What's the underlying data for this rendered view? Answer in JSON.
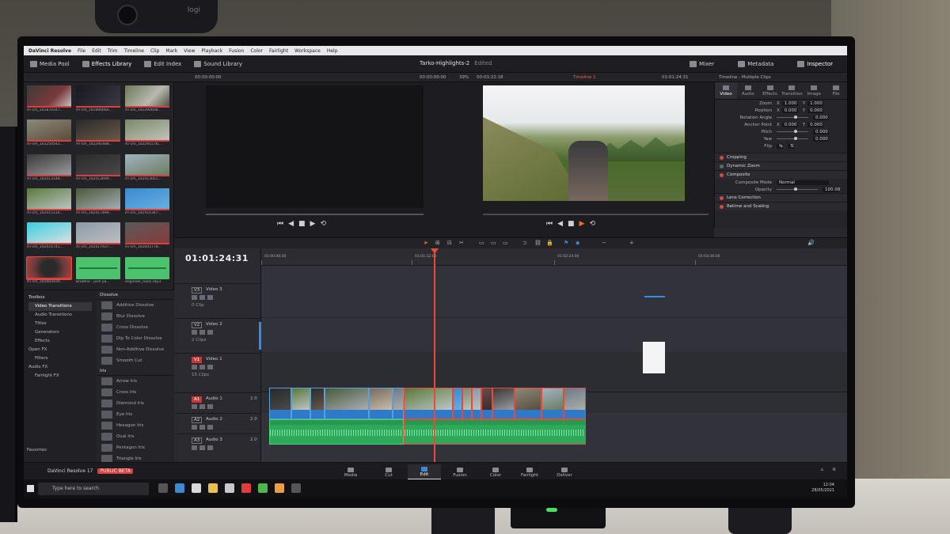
{
  "app": {
    "name": "DaVinci Resolve",
    "project_title": "Tarko-Highlights-2",
    "project_state": "Edited",
    "footer_name": "DaVinci Resolve 17",
    "footer_badge": "PUBLIC BETA"
  },
  "menu": [
    "File",
    "Edit",
    "Trim",
    "Timeline",
    "Clip",
    "Mark",
    "View",
    "Playback",
    "Fusion",
    "Color",
    "Fairlight",
    "Workspace",
    "Help"
  ],
  "toolbar": {
    "media_pool": "Media Pool",
    "effects_library": "Effects Library",
    "edit_index": "Edit Index",
    "sound_library": "Sound Library",
    "mixer": "Mixer",
    "metadata": "Metadata",
    "inspector": "Inspector"
  },
  "subbar": {
    "source_tc": "00:00:00:00",
    "src_duration": "00:00:00:00",
    "zoom": "39%",
    "prog_tc_left": "00:03:22:18",
    "timeline_name": "Timeline 1",
    "prog_tc": "01:01:24:31",
    "inspector_title": "Timeline - Multiple Clips"
  },
  "media_clips": [
    {
      "label": "AT-cm_101870547..."
    },
    {
      "label": "AT-cm_101990666..."
    },
    {
      "label": "AT-cm_102290606..."
    },
    {
      "label": "AT-cm_102250542..."
    },
    {
      "label": "AT-cm_102291488..."
    },
    {
      "label": "AT-cm_102291578..."
    },
    {
      "label": "AT-cm_102413148..."
    },
    {
      "label": "AT-cm_102413699..."
    },
    {
      "label": "AT-cm_102413051..."
    },
    {
      "label": "AT-cm_102415116..."
    },
    {
      "label": "AT-cm_102417499..."
    },
    {
      "label": "AT-cm_102416347..."
    },
    {
      "label": "AT-cm_102416741..."
    },
    {
      "label": "AT-cm_102417937..."
    },
    {
      "label": "AT-cm_102605778..."
    },
    {
      "label": "AT-cm_102605939..."
    },
    {
      "label": "Breathe - josh pa..."
    },
    {
      "label": "engineer_no01.mp3"
    }
  ],
  "effects": {
    "tree": [
      "Toolbox",
      "Video Transitions",
      "Audio Transitions",
      "Titles",
      "Generators",
      "Effects",
      "Open FX",
      "Filters",
      "Audio FX",
      "Fairlight FX"
    ],
    "favorites": "Favorites",
    "dissolve_header": "Dissolve",
    "dissolve": [
      "Additive Dissolve",
      "Blur Dissolve",
      "Cross Dissolve",
      "Dip To Color Dissolve",
      "Non-Additive Dissolve",
      "Smooth Cut"
    ],
    "iris_header": "Iris",
    "iris": [
      "Arrow Iris",
      "Cross Iris",
      "Diamond Iris",
      "Eye Iris",
      "Hexagon Iris",
      "Oval Iris",
      "Pentagon Iris",
      "Triangle Iris"
    ]
  },
  "inspector": {
    "tabs": [
      "Video",
      "Audio",
      "Effects",
      "Transition",
      "Image",
      "File"
    ],
    "zoom_label": "Zoom",
    "zoom_x": "1.000",
    "zoom_y": "1.000",
    "position_label": "Position",
    "position_x": "0.000",
    "position_y": "0.000",
    "rotation_label": "Rotation Angle",
    "rotation": "0.000",
    "anchor_label": "Anchor Point",
    "anchor_x": "0.000",
    "anchor_y": "0.000",
    "pitch_label": "Pitch",
    "pitch": "0.000",
    "yaw_label": "Yaw",
    "yaw": "0.000",
    "flip_label": "Flip",
    "cropping": "Cropping",
    "dynamic_zoom": "Dynamic Zoom",
    "composite": "Composite",
    "composite_mode_label": "Composite Mode",
    "composite_mode": "Normal",
    "opacity_label": "Opacity",
    "opacity": "100.00",
    "lens_correction": "Lens Correction",
    "retime_scaling": "Retime and Scaling"
  },
  "timeline": {
    "timecode": "01:01:24:31",
    "ruler": [
      "01:00:00:00",
      "01:01:12:00",
      "01:02:24:00",
      "01:03:36:00"
    ],
    "tracks": [
      {
        "tag": "V3",
        "name": "Video 3",
        "count": "0 Clip"
      },
      {
        "tag": "V2",
        "name": "Video 2",
        "count": "2 Clips"
      },
      {
        "tag": "V1",
        "name": "Video 1",
        "count": "15 Clips"
      },
      {
        "tag": "A1",
        "name": "Audio 1",
        "vol": "2.0"
      },
      {
        "tag": "A2",
        "name": "Audio 2",
        "vol": "2.0"
      },
      {
        "tag": "A3",
        "name": "Audio 3",
        "vol": "2.0"
      }
    ]
  },
  "pages": [
    "Media",
    "Cut",
    "Edit",
    "Fusion",
    "Color",
    "Fairlight",
    "Deliver"
  ],
  "taskbar": {
    "search_placeholder": "Type here to search",
    "time": "12:04",
    "date": "28/05/2021"
  },
  "colors": {
    "playhead": "#e84a3a",
    "video_clip": "#2f7ac8",
    "audio_clip": "#2ea85a",
    "accent": "#ff6a2a"
  }
}
